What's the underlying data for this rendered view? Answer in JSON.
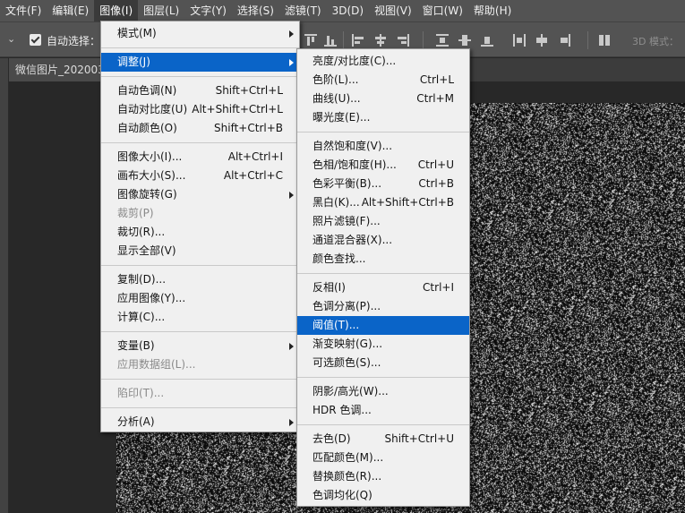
{
  "menubar": {
    "items": [
      "文件(F)",
      "编辑(E)",
      "图像(I)",
      "图层(L)",
      "文字(Y)",
      "选择(S)",
      "滤镜(T)",
      "3D(D)",
      "视图(V)",
      "窗口(W)",
      "帮助(H)"
    ]
  },
  "options": {
    "auto_select_label": "自动选择：",
    "mode_3d_label": "3D 模式："
  },
  "document": {
    "tab_title": "微信图片_202003"
  },
  "image_menu": {
    "items": [
      {
        "label": "模式(M)",
        "shortcut": "",
        "submenu": true
      },
      {
        "divider": true
      },
      {
        "label": "调整(J)",
        "shortcut": "",
        "submenu": true,
        "highlighted": true
      },
      {
        "divider": true
      },
      {
        "label": "自动色调(N)",
        "shortcut": "Shift+Ctrl+L"
      },
      {
        "label": "自动对比度(U)",
        "shortcut": "Alt+Shift+Ctrl+L"
      },
      {
        "label": "自动颜色(O)",
        "shortcut": "Shift+Ctrl+B"
      },
      {
        "divider": true
      },
      {
        "label": "图像大小(I)...",
        "shortcut": "Alt+Ctrl+I"
      },
      {
        "label": "画布大小(S)...",
        "shortcut": "Alt+Ctrl+C"
      },
      {
        "label": "图像旋转(G)",
        "shortcut": "",
        "submenu": true
      },
      {
        "label": "裁剪(P)",
        "shortcut": "",
        "disabled": true
      },
      {
        "label": "裁切(R)...",
        "shortcut": ""
      },
      {
        "label": "显示全部(V)",
        "shortcut": ""
      },
      {
        "divider": true
      },
      {
        "label": "复制(D)...",
        "shortcut": ""
      },
      {
        "label": "应用图像(Y)...",
        "shortcut": ""
      },
      {
        "label": "计算(C)...",
        "shortcut": ""
      },
      {
        "divider": true
      },
      {
        "label": "变量(B)",
        "shortcut": "",
        "submenu": true
      },
      {
        "label": "应用数据组(L)...",
        "shortcut": "",
        "disabled": true
      },
      {
        "divider": true
      },
      {
        "label": "陷印(T)...",
        "shortcut": "",
        "disabled": true
      },
      {
        "divider": true
      },
      {
        "label": "分析(A)",
        "shortcut": "",
        "submenu": true
      }
    ]
  },
  "adjust_menu": {
    "items": [
      {
        "label": "亮度/对比度(C)...",
        "shortcut": ""
      },
      {
        "label": "色阶(L)...",
        "shortcut": "Ctrl+L"
      },
      {
        "label": "曲线(U)...",
        "shortcut": "Ctrl+M"
      },
      {
        "label": "曝光度(E)...",
        "shortcut": ""
      },
      {
        "divider": true
      },
      {
        "label": "自然饱和度(V)...",
        "shortcut": ""
      },
      {
        "label": "色相/饱和度(H)...",
        "shortcut": "Ctrl+U"
      },
      {
        "label": "色彩平衡(B)...",
        "shortcut": "Ctrl+B"
      },
      {
        "label": "黑白(K)...",
        "shortcut": "Alt+Shift+Ctrl+B"
      },
      {
        "label": "照片滤镜(F)...",
        "shortcut": ""
      },
      {
        "label": "通道混合器(X)...",
        "shortcut": ""
      },
      {
        "label": "颜色查找...",
        "shortcut": ""
      },
      {
        "divider": true
      },
      {
        "label": "反相(I)",
        "shortcut": "Ctrl+I"
      },
      {
        "label": "色调分离(P)...",
        "shortcut": ""
      },
      {
        "label": "阈值(T)...",
        "shortcut": "",
        "highlighted": true
      },
      {
        "label": "渐变映射(G)...",
        "shortcut": ""
      },
      {
        "label": "可选颜色(S)...",
        "shortcut": ""
      },
      {
        "divider": true
      },
      {
        "label": "阴影/高光(W)...",
        "shortcut": ""
      },
      {
        "label": "HDR 色调...",
        "shortcut": ""
      },
      {
        "divider": true
      },
      {
        "label": "去色(D)",
        "shortcut": "Shift+Ctrl+U"
      },
      {
        "label": "匹配颜色(M)...",
        "shortcut": ""
      },
      {
        "label": "替换颜色(R)...",
        "shortcut": ""
      },
      {
        "label": "色调均化(Q)",
        "shortcut": ""
      }
    ]
  }
}
